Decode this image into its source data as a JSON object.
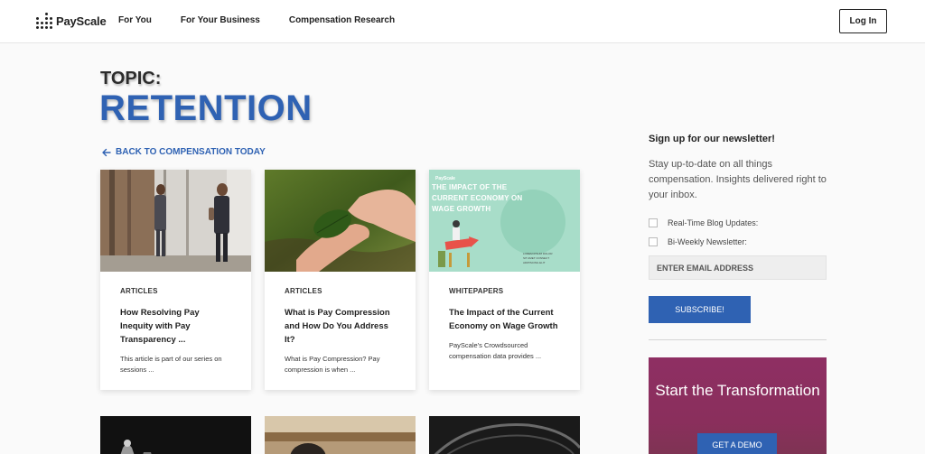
{
  "header": {
    "logo_text": "PayScale",
    "nav": [
      "For You",
      "For Your Business",
      "Compensation Research"
    ],
    "login_label": "Log In"
  },
  "topic": {
    "label": "TOPIC:",
    "title": "RETENTION"
  },
  "back_link": "BACK TO COMPENSATION TODAY",
  "cards": [
    {
      "category": "ARTICLES",
      "title": "How Resolving Pay Inequity with Pay Transparency ...",
      "excerpt": "This article is part of our series on sessions ..."
    },
    {
      "category": "ARTICLES",
      "title": "What is Pay Compression and How Do You Address It?",
      "excerpt": "What is Pay Compression? Pay compression is when ..."
    },
    {
      "category": "WHITEPAPERS",
      "title": "The Impact of the Current Economy on Wage Growth",
      "excerpt": "PayScale's Crowdsourced compensation data provides ...",
      "thumb_heading": "THE IMPACT OF THE CURRENT ECONOMY ON WAGE GROWTH",
      "thumb_brand": "PayScale"
    }
  ],
  "newsletter": {
    "title": "Sign up for our newsletter!",
    "description": "Stay up-to-date on all things compensation. Insights delivered right to your inbox.",
    "options": [
      "Real-Time Blog Updates:",
      "Bi-Weekly Newsletter:"
    ],
    "email_placeholder": "ENTER EMAIL ADDRESS",
    "subscribe_label": "SUBSCRIBE!"
  },
  "promo": {
    "title": "Start the Transformation",
    "button_label": "GET A DEMO"
  },
  "colors": {
    "brand_blue": "#2f62b3",
    "promo_magenta": "#8e2f63",
    "whitepaper_mint": "#a8ddc9"
  }
}
